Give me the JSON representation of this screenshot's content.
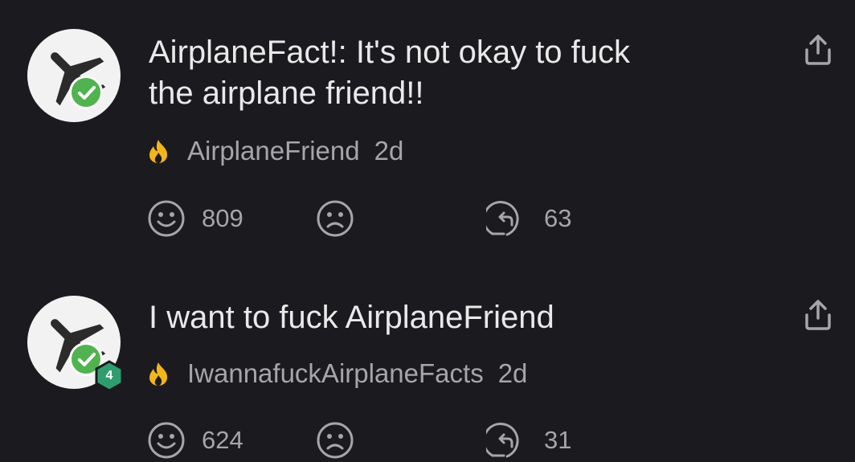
{
  "posts": [
    {
      "line1": "AirplaneFact!: It's not okay to fuck",
      "line2": "the airplane friend!!",
      "author": "AirplaneFriend",
      "age": "2d",
      "likes": "809",
      "replies": "63",
      "badge_level": ""
    },
    {
      "line1": "I want to fuck AirplaneFriend",
      "line2": "",
      "author": "IwannafuckAirplaneFacts",
      "age": "2d",
      "likes": "624",
      "replies": "31",
      "badge_level": "4"
    }
  ],
  "icons": {
    "avatar": "airplane-icon",
    "verified": "checkmark-icon",
    "flame": "flame-icon",
    "like": "smile-face-icon",
    "dislike": "sad-face-icon",
    "reply": "reply-arrow-icon",
    "share": "share-icon"
  },
  "colors": {
    "background": "#1b1b1f",
    "text": "#e9e9ea",
    "muted": "#a5a5aa",
    "verified_green": "#50b34f",
    "flame": "#f2b619",
    "level_badge": "#2f9e6e"
  }
}
